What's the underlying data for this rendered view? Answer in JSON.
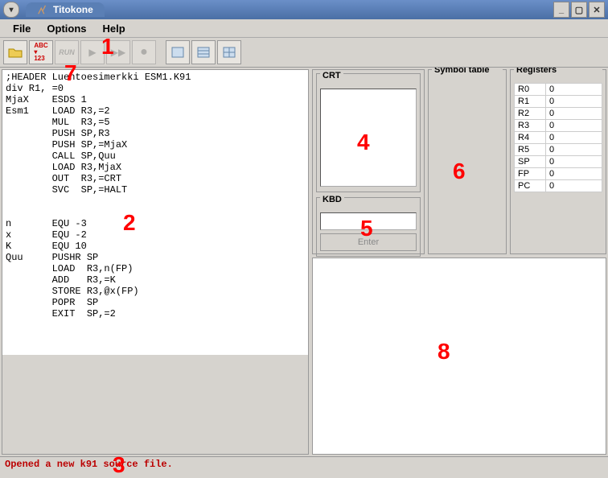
{
  "window": {
    "title": "Titokone"
  },
  "menu": {
    "file": "File",
    "options": "Options",
    "help": "Help"
  },
  "code": ";HEADER Luentoesimerkki ESM1.K91\ndiv R1, =0\nMjaX    ESDS 1\nEsm1    LOAD R3,=2\n        MUL  R3,=5\n        PUSH SP,R3\n        PUSH SP,=MjaX\n        CALL SP,Quu\n        LOAD R3,MjaX\n        OUT  R3,=CRT\n        SVC  SP,=HALT\n\n\nn       EQU -3\nx       EQU -2\nK       EQU 10\nQuu     PUSHR SP\n        LOAD  R3,n(FP)\n        ADD   R3,=K\n        STORE R3,@x(FP)\n        POPR  SP\n        EXIT  SP,=2",
  "panels": {
    "crt": "CRT",
    "kbd": "KBD",
    "kbd_btn": "Enter",
    "symtab": "Symbol table",
    "registers": "Registers"
  },
  "registers": [
    {
      "n": "R0",
      "v": "0"
    },
    {
      "n": "R1",
      "v": "0"
    },
    {
      "n": "R2",
      "v": "0"
    },
    {
      "n": "R3",
      "v": "0"
    },
    {
      "n": "R4",
      "v": "0"
    },
    {
      "n": "R5",
      "v": "0"
    },
    {
      "n": "SP",
      "v": "0"
    },
    {
      "n": "FP",
      "v": "0"
    },
    {
      "n": "PC",
      "v": "0"
    }
  ],
  "status": "Opened a new k91 source file.",
  "annotations": {
    "1": "1",
    "2": "2",
    "3": "3",
    "4": "4",
    "5": "5",
    "6": "6",
    "7": "7",
    "8": "8"
  }
}
